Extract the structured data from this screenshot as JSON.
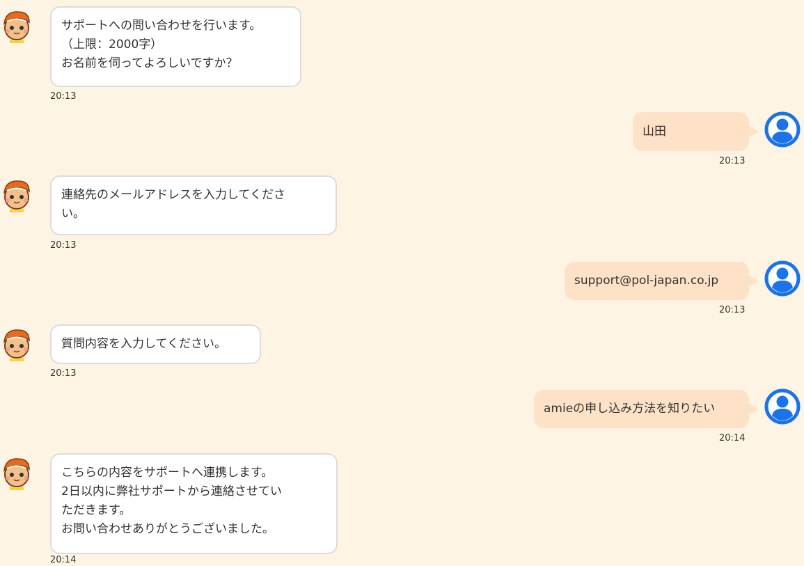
{
  "colors": {
    "background": "#fef4e3",
    "bot_bubble": "#ffffff",
    "bot_border": "#dcdcdc",
    "user_bubble": "#fde2c7",
    "user_avatar": "#1a73e8"
  },
  "messages": [
    {
      "sender": "bot",
      "text": "サポートへの問い合わせを行います。\n（上限：2000字）\nお名前を伺ってよろしいですか？",
      "time": "20:13"
    },
    {
      "sender": "user",
      "text": "山田",
      "time": "20:13"
    },
    {
      "sender": "bot",
      "text": "連絡先のメールアドレスを入力してくださ\nい。",
      "time": "20:13"
    },
    {
      "sender": "user",
      "text": "support@pol-japan.co.jp",
      "time": "20:13"
    },
    {
      "sender": "bot",
      "text": "質問内容を入力してください。",
      "time": "20:13"
    },
    {
      "sender": "user",
      "text": "amieの申し込み方法を知りたい",
      "time": "20:14"
    },
    {
      "sender": "bot",
      "text": "こちらの内容をサポートへ連携します。\n2日以内に弊社サポートから連絡させてい\nただきます。\nお問い合わせありがとうございました。",
      "time": "20:14"
    }
  ]
}
